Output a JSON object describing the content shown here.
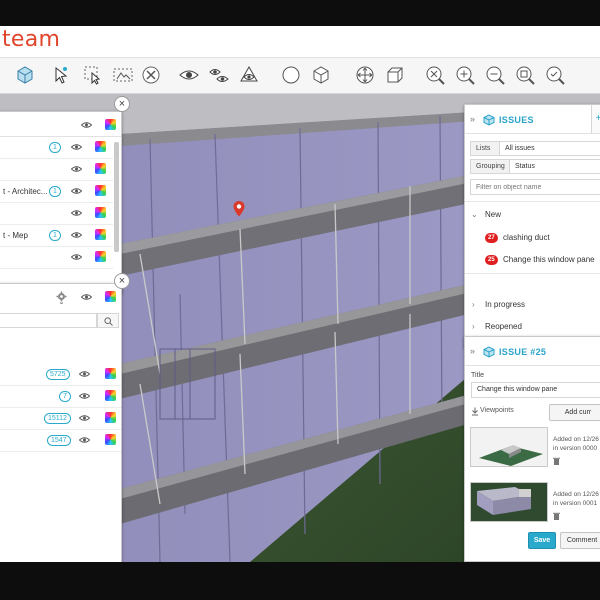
{
  "brand": {
    "name": "team"
  },
  "colors": {
    "accent": "#29aacd",
    "brand": "#e0442a",
    "badge_red": "#e02020"
  },
  "toolbar": {
    "tools": [
      "cube-view-icon",
      "select-cursor-icon",
      "select-box-icon",
      "select-frame-icon",
      "clear-selection-icon",
      "show-icon",
      "show-all-icon",
      "isolate-icon",
      "sphere-icon",
      "cube-navigation-icon",
      "move-icon",
      "box-icon",
      "zoom-fit-icon",
      "zoom-in-icon",
      "zoom-out-icon",
      "zoom-region-icon",
      "search-zoom-icon"
    ]
  },
  "models_panel": {
    "rows": [
      {
        "label": "",
        "count": "1"
      },
      {
        "label": "",
        "count": ""
      },
      {
        "label": "t - Architec...",
        "count": "1"
      },
      {
        "label": "",
        "count": ""
      },
      {
        "label": "t - Mep",
        "count": "1"
      },
      {
        "label": "",
        "count": ""
      }
    ]
  },
  "types_panel": {
    "search_placeholder": "",
    "rows": [
      {
        "label": "",
        "count": "5725"
      },
      {
        "label": "",
        "count": "7"
      },
      {
        "label": "",
        "count": "15112"
      },
      {
        "label": "",
        "count": "1547"
      }
    ]
  },
  "issues_panel": {
    "title": "ISSUES",
    "lists_label": "Lists",
    "lists_value": "All issues",
    "grouping_label": "Grouping",
    "grouping_value": "Status",
    "filter_placeholder": "Filter on object name",
    "groups": [
      {
        "name": "New",
        "expanded": true,
        "items": [
          {
            "count": "27",
            "label": "clashing duct"
          },
          {
            "count": "25",
            "label": "Change this window pane"
          }
        ]
      },
      {
        "name": "In progress",
        "expanded": false
      },
      {
        "name": "Reopened",
        "expanded": false
      }
    ]
  },
  "issue_detail": {
    "title": "ISSUE #25",
    "title_label": "Title",
    "title_value": "Change this window pane",
    "viewpoints_label": "Viewpoints",
    "add_button": "Add curr",
    "viewpoints": [
      {
        "added": "Added on 12/26",
        "version": "in version 0000"
      },
      {
        "added": "Added on 12/26",
        "version": "in version 0001"
      }
    ],
    "save_label": "Save",
    "comment_label": "Comment"
  }
}
